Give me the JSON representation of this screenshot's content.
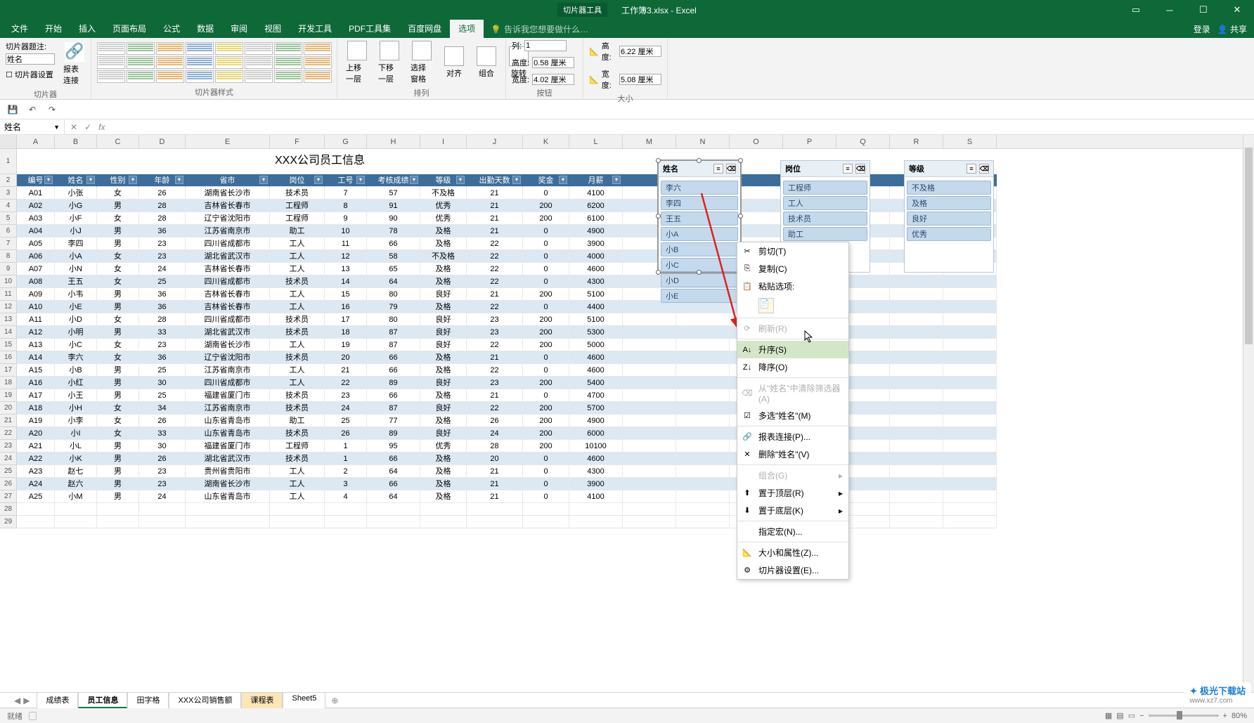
{
  "titlebar": {
    "context": "切片器工具",
    "doc": "工作簿3.xlsx - Excel"
  },
  "tabs": [
    "文件",
    "开始",
    "插入",
    "页面布局",
    "公式",
    "数据",
    "审阅",
    "视图",
    "开发工具",
    "PDF工具集",
    "百度网盘",
    "选项"
  ],
  "active_tab": "选项",
  "tell_me": "告诉我您想要做什么…",
  "account": {
    "login": "登录",
    "share": "共享"
  },
  "caption": {
    "label": "切片器题注:",
    "value": "姓名",
    "settings": "切片器设置",
    "report": "报表连接"
  },
  "ribbon_groups": {
    "slicer": "切片器",
    "styles": "切片器样式",
    "arrange": "排列",
    "buttons": "按钮",
    "size": "大小"
  },
  "arrange": {
    "up": "上移一层",
    "down": "下移一层",
    "pane": "选择窗格",
    "align": "对齐",
    "group": "组合",
    "rotate": "旋转"
  },
  "buttons": {
    "cols_lbl": "列:",
    "cols": "1",
    "h_lbl": "高度:",
    "h": "0.58 厘米",
    "w_lbl": "宽度:",
    "w": "4.02 厘米"
  },
  "size": {
    "h_lbl": "高度:",
    "h": "6.22 厘米",
    "w_lbl": "宽度:",
    "w": "5.08 厘米"
  },
  "namebox": "姓名",
  "cols": [
    "A",
    "B",
    "C",
    "D",
    "E",
    "F",
    "G",
    "H",
    "I",
    "J",
    "K",
    "L",
    "M",
    "N",
    "O",
    "P",
    "Q",
    "R",
    "S"
  ],
  "widths": [
    54,
    60,
    60,
    66,
    120,
    78,
    60,
    76,
    66,
    80,
    66,
    76,
    76,
    76,
    76,
    76,
    76,
    76,
    76
  ],
  "title": "XXX公司员工信息",
  "headers": [
    "编号",
    "姓名",
    "性别",
    "年龄",
    "省市",
    "岗位",
    "工号",
    "考核成绩",
    "等级",
    "出勤天数",
    "奖金",
    "月薪"
  ],
  "rows": [
    [
      "A01",
      "小张",
      "女",
      "26",
      "湖南省长沙市",
      "技术员",
      "7",
      "57",
      "不及格",
      "21",
      "0",
      "4100"
    ],
    [
      "A02",
      "小G",
      "男",
      "28",
      "吉林省长春市",
      "工程师",
      "8",
      "91",
      "优秀",
      "21",
      "200",
      "6200"
    ],
    [
      "A03",
      "小F",
      "女",
      "28",
      "辽宁省沈阳市",
      "工程师",
      "9",
      "90",
      "优秀",
      "21",
      "200",
      "6100"
    ],
    [
      "A04",
      "小J",
      "男",
      "36",
      "江苏省南京市",
      "助工",
      "10",
      "78",
      "及格",
      "21",
      "0",
      "4900"
    ],
    [
      "A05",
      "李四",
      "男",
      "23",
      "四川省成都市",
      "工人",
      "11",
      "66",
      "及格",
      "22",
      "0",
      "3900"
    ],
    [
      "A06",
      "小A",
      "女",
      "23",
      "湖北省武汉市",
      "工人",
      "12",
      "58",
      "不及格",
      "22",
      "0",
      "4000"
    ],
    [
      "A07",
      "小N",
      "女",
      "24",
      "吉林省长春市",
      "工人",
      "13",
      "65",
      "及格",
      "22",
      "0",
      "4600"
    ],
    [
      "A08",
      "王五",
      "女",
      "25",
      "四川省成都市",
      "技术员",
      "14",
      "64",
      "及格",
      "22",
      "0",
      "4300"
    ],
    [
      "A09",
      "小韦",
      "男",
      "36",
      "吉林省长春市",
      "工人",
      "15",
      "80",
      "良好",
      "21",
      "200",
      "5100"
    ],
    [
      "A10",
      "小E",
      "男",
      "36",
      "吉林省长春市",
      "工人",
      "16",
      "79",
      "及格",
      "22",
      "0",
      "4400"
    ],
    [
      "A11",
      "小D",
      "女",
      "28",
      "四川省成都市",
      "技术员",
      "17",
      "80",
      "良好",
      "23",
      "200",
      "5100"
    ],
    [
      "A12",
      "小明",
      "男",
      "33",
      "湖北省武汉市",
      "技术员",
      "18",
      "87",
      "良好",
      "23",
      "200",
      "5300"
    ],
    [
      "A13",
      "小C",
      "女",
      "23",
      "湖南省长沙市",
      "工人",
      "19",
      "87",
      "良好",
      "22",
      "200",
      "5000"
    ],
    [
      "A14",
      "李六",
      "女",
      "36",
      "辽宁省沈阳市",
      "技术员",
      "20",
      "66",
      "及格",
      "21",
      "0",
      "4600"
    ],
    [
      "A15",
      "小B",
      "男",
      "25",
      "江苏省南京市",
      "工人",
      "21",
      "66",
      "及格",
      "22",
      "0",
      "4600"
    ],
    [
      "A16",
      "小红",
      "男",
      "30",
      "四川省成都市",
      "工人",
      "22",
      "89",
      "良好",
      "23",
      "200",
      "5400"
    ],
    [
      "A17",
      "小王",
      "男",
      "25",
      "福建省厦门市",
      "技术员",
      "23",
      "66",
      "及格",
      "21",
      "0",
      "4700"
    ],
    [
      "A18",
      "小H",
      "女",
      "34",
      "江苏省南京市",
      "技术员",
      "24",
      "87",
      "良好",
      "22",
      "200",
      "5700"
    ],
    [
      "A19",
      "小李",
      "女",
      "26",
      "山东省青岛市",
      "助工",
      "25",
      "77",
      "及格",
      "26",
      "200",
      "4900"
    ],
    [
      "A20",
      "小I",
      "女",
      "33",
      "山东省青岛市",
      "技术员",
      "26",
      "89",
      "良好",
      "24",
      "200",
      "6000"
    ],
    [
      "A21",
      "小L",
      "男",
      "30",
      "福建省厦门市",
      "工程师",
      "1",
      "95",
      "优秀",
      "28",
      "200",
      "10100"
    ],
    [
      "A22",
      "小K",
      "男",
      "26",
      "湖北省武汉市",
      "技术员",
      "1",
      "66",
      "及格",
      "20",
      "0",
      "4600"
    ],
    [
      "A23",
      "赵七",
      "男",
      "23",
      "贵州省贵阳市",
      "工人",
      "2",
      "64",
      "及格",
      "21",
      "0",
      "4300"
    ],
    [
      "A24",
      "赵六",
      "男",
      "23",
      "湖南省长沙市",
      "工人",
      "3",
      "66",
      "及格",
      "21",
      "0",
      "3900"
    ],
    [
      "A25",
      "小M",
      "男",
      "24",
      "山东省青岛市",
      "工人",
      "4",
      "64",
      "及格",
      "21",
      "0",
      "4100"
    ]
  ],
  "slicers": {
    "name": {
      "title": "姓名",
      "items": [
        "李六",
        "李四",
        "王五",
        "小A",
        "小B",
        "小C",
        "小D",
        "小E"
      ]
    },
    "job": {
      "title": "岗位",
      "items": [
        "工程师",
        "工人",
        "技术员",
        "助工"
      ]
    },
    "grade": {
      "title": "等级",
      "items": [
        "不及格",
        "及格",
        "良好",
        "优秀"
      ]
    }
  },
  "ctxmenu": {
    "cut": "剪切(T)",
    "copy": "复制(C)",
    "paste_opt": "粘贴选项:",
    "refresh": "刷新(R)",
    "sort_asc": "升序(S)",
    "sort_desc": "降序(O)",
    "clear": "从\"姓名\"中清除筛选器(A)",
    "multi": "多选\"姓名\"(M)",
    "report": "报表连接(P)...",
    "delete": "删除\"姓名\"(V)",
    "group": "组合(G)",
    "top": "置于顶层(R)",
    "bottom": "置于底层(K)",
    "macro": "指定宏(N)...",
    "sizeprop": "大小和属性(Z)...",
    "settings": "切片器设置(E)..."
  },
  "sheets": [
    "成绩表",
    "员工信息",
    "田字格",
    "XXX公司销售额",
    "课程表",
    "Sheet5"
  ],
  "active_sheet": "员工信息",
  "hl_sheet": "课程表",
  "status": {
    "ready": "就绪",
    "rec": "",
    "zoom": "80%"
  },
  "watermark": {
    "brand": "极光下载站",
    "url": "www.xz7.com"
  }
}
